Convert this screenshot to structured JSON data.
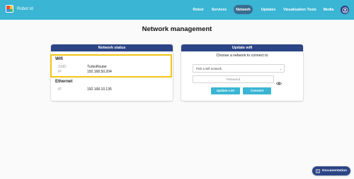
{
  "app": {
    "name": "Robot Id"
  },
  "nav": {
    "items": [
      "Robot",
      "Services",
      "Network",
      "Updates",
      "Visualisation Tools",
      "Media"
    ],
    "active": "Network"
  },
  "page": {
    "title": "Network management"
  },
  "network_status": {
    "header": "Network status",
    "wifi": {
      "title": "Wifi",
      "ssid_label": "SSID",
      "ssid": "TurboRouter",
      "ip_label": "IP",
      "ip": "192.168.50.204"
    },
    "ethernet": {
      "title": "Ethernet",
      "ip_label": "IP",
      "ip": "192.168.10.135"
    }
  },
  "update_wifi": {
    "header": "Update wifi",
    "instruction": "Choose a network to connect to",
    "select_value": "Pick a wifi network",
    "password_placeholder": "Password",
    "update_list_label": "Update List",
    "connect_label": "Connect"
  },
  "documentation": {
    "label": "Documentation"
  },
  "colors": {
    "topbar": "#3ab5d4",
    "header": "#2c4586",
    "nav_active": "#3a6c8f",
    "highlight": "#f2c516"
  },
  "icons": {
    "logo": "robot-logo-icon",
    "user": "user-icon",
    "eye": "eye-icon",
    "chevron": "chevron-down-icon",
    "book": "book-icon"
  }
}
